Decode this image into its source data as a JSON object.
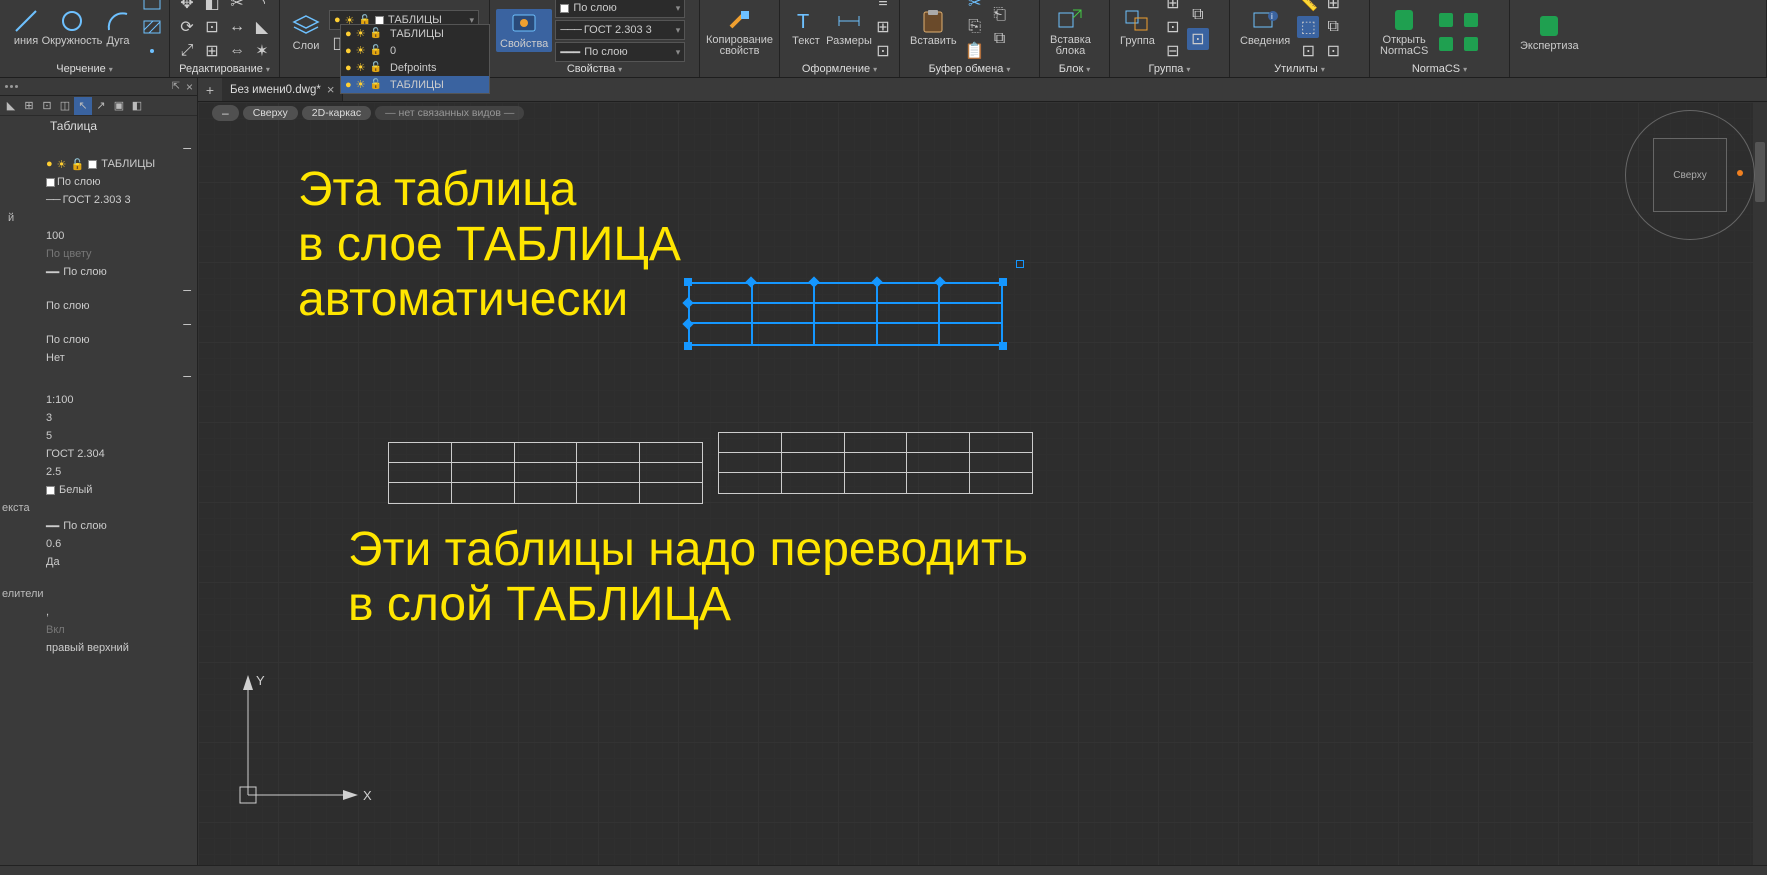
{
  "ribbon": {
    "panels": {
      "drawing": {
        "label": "Черчение",
        "items": {
          "line": "иния",
          "circle": "Окружность",
          "arc": "Дуга"
        }
      },
      "editing": {
        "label": "Редактирование"
      },
      "layers": {
        "label": "Слои",
        "btn": "Слои",
        "dd_value": "ТАБЛИЦЫ",
        "list": [
          {
            "name": "ТАБЛИЦЫ",
            "color": "#fff"
          },
          {
            "name": "0",
            "color": "#fff"
          },
          {
            "name": "Defpoints",
            "color": "#fff"
          },
          {
            "name": "ТАБЛИЦЫ",
            "color": "#fff",
            "selected": true
          }
        ]
      },
      "properties": {
        "label": "Свойства",
        "btn": "Свойства",
        "bycolor": "По слою",
        "linetype": "ГОСТ 2.303 3",
        "lineweight": "По слою"
      },
      "clipboard": {
        "label": "Буфер обмена",
        "copy": "Копирование\nсвойств",
        "paste": "Вставить",
        "block": "Вставка\nблока"
      },
      "format": {
        "label": "Оформление",
        "text": "Текст",
        "dims": "Размеры"
      },
      "block": {
        "label": "Блок"
      },
      "group": {
        "label": "Группа",
        "btn": "Группа"
      },
      "utilities": {
        "label": "Утилиты",
        "btn": "Сведения"
      },
      "normacs": {
        "label": "NormaCS",
        "open": "Открыть\nNormaCS",
        "expert": "Экспертиза"
      }
    }
  },
  "docbar": {
    "tab": "Без имени0.dwg*"
  },
  "viewrow": {
    "view": "Сверху",
    "style": "2D-каркас",
    "linked": "— нет связанных видов —"
  },
  "sidepanel": {
    "title": "Таблица",
    "layer_value": "ТАБЛИЦЫ",
    "linetype": "ГОСТ 2.303 3",
    "scale_ind": "100",
    "bycolor_dis": "По цвету",
    "bylayer1": "По слою",
    "bylayer2": "По слою",
    "bylayer3": "По слою",
    "none": "Нет",
    "s_1_100": "1:100",
    "s_3": "3",
    "s_5": "5",
    "gost": "ГОСТ 2.304",
    "s_25": "2.5",
    "white": "Белый",
    "text_label": "екста",
    "bylayer4": "По слою",
    "s_06": "0.6",
    "yes": "Да",
    "sep_label": "елители",
    "sep": ",",
    "on": "Вкл",
    "pos": "правый верхний"
  },
  "canvas": {
    "annot1": "Эта таблица\nв слое ТАБЛИЦА\nавтоматически",
    "annot2": "Эти таблицы надо переводить\nв слой ТАБЛИЦА",
    "ucs_x": "X",
    "ucs_y": "Y",
    "viewcube": "Сверху"
  }
}
